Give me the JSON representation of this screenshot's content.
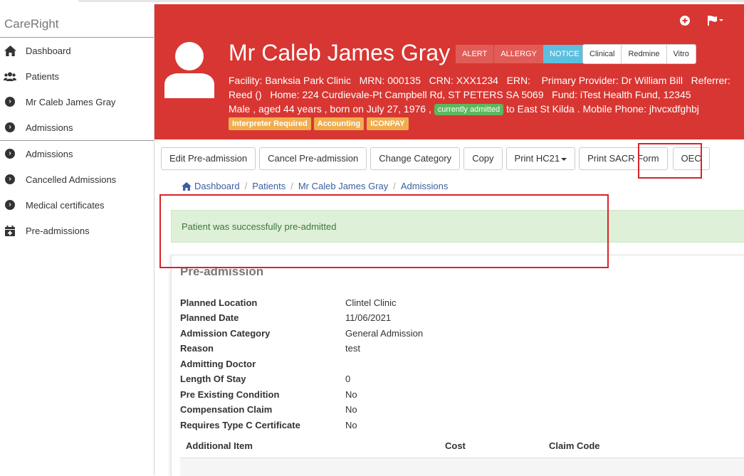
{
  "app": {
    "brand": "CareRight"
  },
  "sidebar": {
    "items": [
      {
        "label": "Dashboard",
        "icon": "home-icon"
      },
      {
        "label": "Patients",
        "icon": "users-icon"
      },
      {
        "label": "Mr Caleb James Gray",
        "icon": "chevron-circle-right-icon"
      },
      {
        "label": "Admissions",
        "icon": "chevron-circle-right-icon"
      },
      {
        "label": "Admissions",
        "icon": "chevron-circle-right-icon"
      },
      {
        "label": "Cancelled Admissions",
        "icon": "chevron-circle-right-icon"
      },
      {
        "label": "Medical certificates",
        "icon": "chevron-circle-right-icon"
      },
      {
        "label": "Pre-admissions",
        "icon": "calendar-plus-icon"
      }
    ]
  },
  "header": {
    "bg_color": "#d83632",
    "patient_name": "Mr Caleb James Gray",
    "badges": {
      "alert": "ALERT",
      "allergy": "ALLERGY",
      "notice": "NOTICE"
    },
    "link_buttons": [
      "Clinical",
      "Redmine",
      "Vitro"
    ],
    "info_line1": "Facility: Banksia Park Clinic   MRN: 000135   CRN: XXX1234   ERN:    Primary Provider: Dr William Bill   Referrer:",
    "info_line2": "Reed ()   Home: 224 Curdievale-Pt Campbell Rd, ST PETERS SA 5069   Fund: iTest Health Fund, 12345",
    "info_line3_pre": "Male , aged 44 years , born on July 27, 1976 ,",
    "info_line3_label": "currently admitted",
    "info_line3_post": "to East St Kilda . Mobile Phone: jhvcxdfghbj",
    "tags": [
      "Interpreter Required",
      "Accounting",
      "ICONPAY"
    ]
  },
  "actions": {
    "edit_pre_admission": "Edit Pre-admission",
    "cancel_pre_admission": "Cancel Pre-admission",
    "change_category": "Change Category",
    "copy": "Copy",
    "print_hc21": "Print HC21",
    "print_sacr": "Print SACR Form",
    "oec": "OEC"
  },
  "breadcrumb": {
    "dashboard": "Dashboard",
    "patients": "Patients",
    "patient": "Mr Caleb James Gray",
    "admissions": "Admissions"
  },
  "alert": {
    "message": "Patient was successfully pre-admitted"
  },
  "panel": {
    "title": "Pre-admission",
    "fields": [
      {
        "label": "Planned Location",
        "value": "Clintel Clinic"
      },
      {
        "label": "Planned Date",
        "value": "11/06/2021"
      },
      {
        "label": "Admission Category",
        "value": "General Admission"
      },
      {
        "label": "Reason",
        "value": "test"
      },
      {
        "label": "Admitting Doctor",
        "value": ""
      },
      {
        "label": "Length Of Stay",
        "value": "0"
      },
      {
        "label": "Pre Existing Condition",
        "value": "No"
      },
      {
        "label": "Compensation Claim",
        "value": "No"
      },
      {
        "label": "Requires Type C Certificate",
        "value": "No"
      }
    ],
    "table_headers": {
      "item": "Additional Item",
      "cost": "Cost",
      "claim_code": "Claim Code"
    }
  }
}
